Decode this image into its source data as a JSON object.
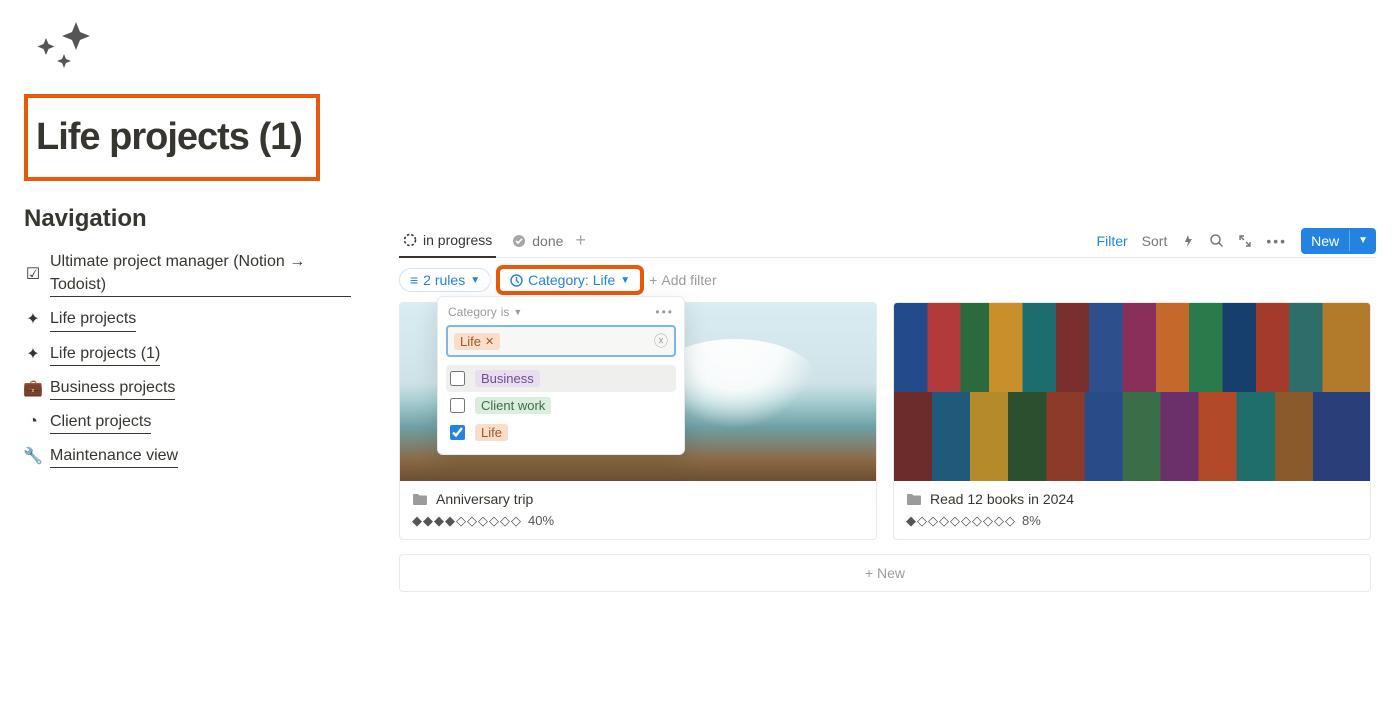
{
  "page": {
    "title": "Life projects (1)"
  },
  "nav": {
    "heading": "Navigation",
    "items": [
      {
        "label": "Ultimate project manager (Notion → Todoist)",
        "icon": "checkbox"
      },
      {
        "label": "Life projects",
        "icon": "sparkle"
      },
      {
        "label": "Life projects (1)",
        "icon": "sparkle"
      },
      {
        "label": "Business projects",
        "icon": "briefcase"
      },
      {
        "label": "Client projects",
        "icon": "user-circle"
      },
      {
        "label": "Maintenance view",
        "icon": "wrench"
      }
    ]
  },
  "tabs": {
    "items": [
      {
        "label": "in progress",
        "active": true,
        "icon": "dashed-circle"
      },
      {
        "label": "done",
        "active": false,
        "icon": "check-badge"
      }
    ]
  },
  "toolbar": {
    "filter": "Filter",
    "sort": "Sort",
    "new_label": "New"
  },
  "filters": {
    "rules_pill": "2 rules",
    "category_pill": "Category: Life",
    "add_filter": "Add filter"
  },
  "popover": {
    "property": "Category",
    "condition": "is",
    "selected_chip": "Life",
    "options": [
      {
        "label": "Business",
        "checked": false,
        "cls": "business"
      },
      {
        "label": "Client work",
        "checked": false,
        "cls": "client"
      },
      {
        "label": "Life",
        "checked": true,
        "cls": "life"
      }
    ]
  },
  "cards": [
    {
      "title": "Anniversary trip",
      "filled": 4,
      "total": 10,
      "pct": "40%"
    },
    {
      "title": "Read 12 books in 2024",
      "filled": 1,
      "total": 10,
      "pct": "8%"
    }
  ],
  "new_card": "New"
}
